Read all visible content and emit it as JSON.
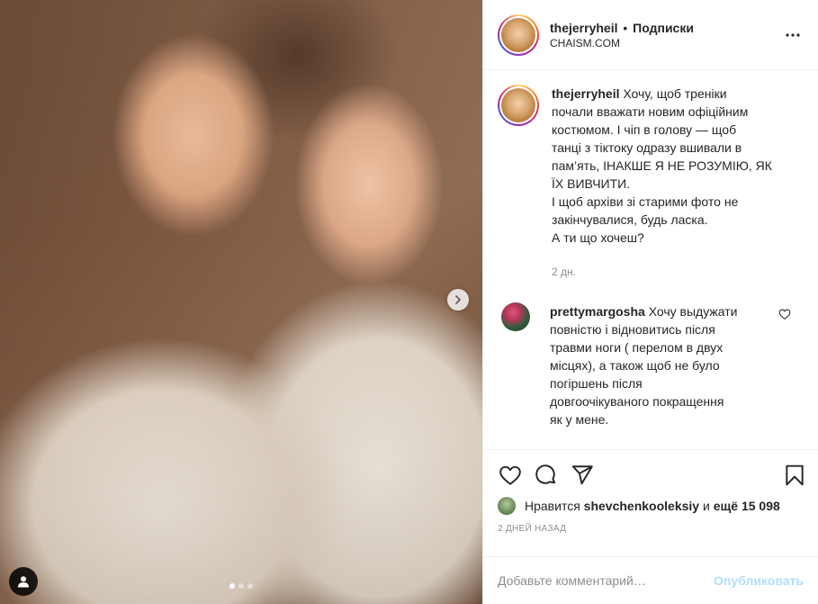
{
  "header": {
    "username": "thejerryheil",
    "separator": "•",
    "follow_state": "Подписки",
    "location": "CHAISM.COM",
    "more_icon": "more-horizontal-icon"
  },
  "caption": {
    "username": "thejerryheil",
    "lines": [
      "Хочу, щоб треніки",
      "почали вважати новим офіційним",
      "костюмом. І чіп в голову — щоб",
      "танці з тіктоку одразу вшивали в",
      "пам’ять, ІНАКШЕ Я НЕ РОЗУМІЮ, ЯК",
      "ЇХ ВИВЧИТИ.",
      "І щоб архіви зі старими фото не",
      "закінчувалися, будь ласка.",
      "А ти що хочеш?"
    ],
    "age": "2 дн."
  },
  "comments": [
    {
      "username": "prettymargosha",
      "lines": [
        "Хочу выдужати",
        "повністю і відновитись після",
        "травми ноги ( перелом в двух",
        "місцях), а також щоб не було",
        "погіршень після",
        "довгоочікуваного покращення",
        "як у мене."
      ]
    }
  ],
  "likes": {
    "prefix": "Нравится",
    "user": "shevchenkooleksiy",
    "conjunction": "и",
    "others": "ещё 15 098"
  },
  "date": "2 ДНЕЙ НАЗАД",
  "add_comment": {
    "placeholder": "Добавьте комментарий…",
    "post_label": "Опубликовать"
  },
  "carousel": {
    "total": 3,
    "active": 1
  },
  "colors": {
    "text": "#262626",
    "muted": "#8e8e8e",
    "post_button_disabled": "#b2dffc",
    "border": "#efefef"
  }
}
